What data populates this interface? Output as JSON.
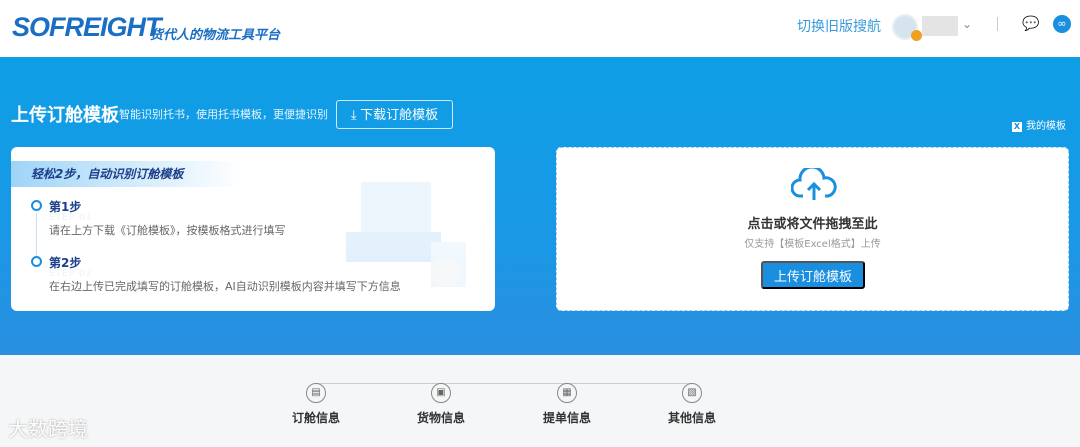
{
  "header": {
    "logo": "SOFREIGHT",
    "slogan": "货代人的物流工具平台",
    "old_nav": "切换旧版搜航"
  },
  "banner": {
    "title": "上传订舱模板",
    "subtitle": "智能识别托书，使用托书模板，更便捷识别",
    "download_button": "下载订舱模板",
    "my_templates": "我的模板"
  },
  "guide": {
    "ribbon": "轻松2步，自动识别订舱模板",
    "steps": [
      {
        "name": "第1步",
        "en": "STEP 01",
        "desc": "请在上方下载《订舱模板》，按模板格式进行填写"
      },
      {
        "name": "第2步",
        "en": "STEP 02",
        "desc": "在右边上传已完成填写的订舱模板，AI自动识别模板内容并填写下方信息"
      }
    ]
  },
  "upload": {
    "drop_text": "点击或将文件拖拽至此",
    "hint": "仅支持【模板Excel格式】上传",
    "button": "上传订舱模板"
  },
  "progress": {
    "steps": [
      "订舱信息",
      "货物信息",
      "提单信息",
      "其他信息"
    ]
  },
  "watermark": "大数跨境"
}
